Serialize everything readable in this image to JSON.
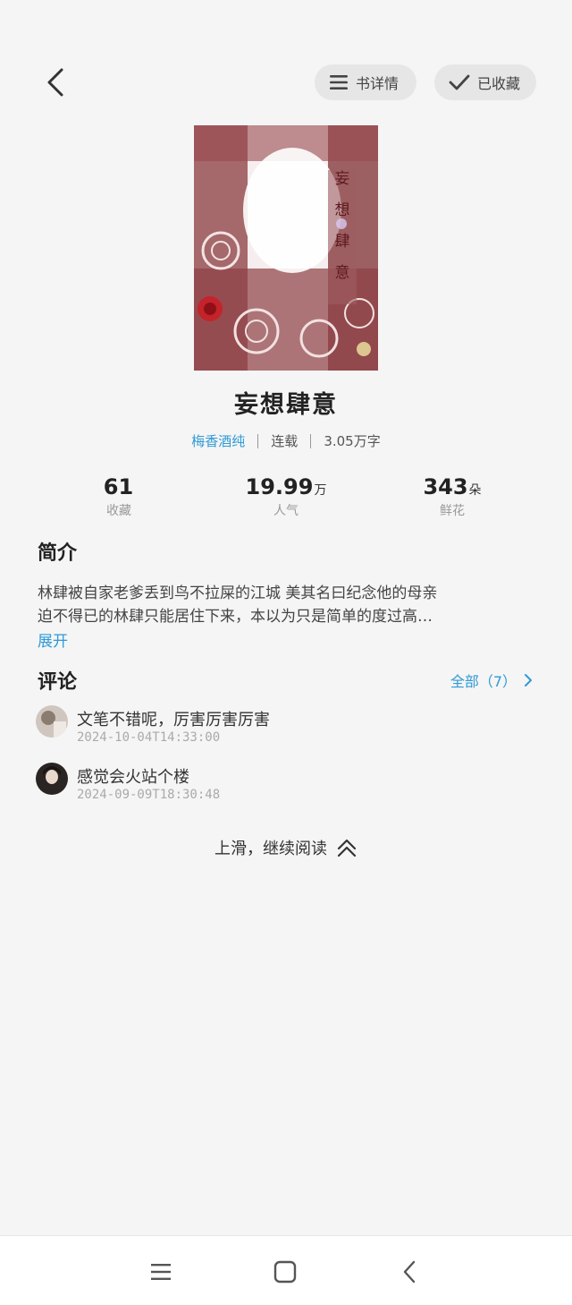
{
  "header": {
    "detail_label": "书详情",
    "fav_label": "已收藏"
  },
  "book": {
    "title": "妄想肆意",
    "author": "梅香酒纯",
    "status": "连载",
    "word_count": "3.05万字"
  },
  "stats": [
    {
      "value": "61",
      "unit": "",
      "label": "收藏"
    },
    {
      "value": "19.99",
      "unit": "万",
      "label": "人气"
    },
    {
      "value": "343",
      "unit": "朵",
      "label": "鲜花"
    }
  ],
  "intro": {
    "heading": "简介",
    "line1": "林肆被自家老爹丢到鸟不拉屎的江城 美其名曰纪念他的母亲",
    "line2": "迫不得已的林肆只能居住下来，本以为只是简单的度过高…",
    "expand": "展开"
  },
  "comments": {
    "heading": "评论",
    "all_label": "全部（7）",
    "items": [
      {
        "text": "文笔不错呢，厉害厉害厉害",
        "time": "2024-10-04T14:33:00"
      },
      {
        "text": "感觉会火站个楼",
        "time": "2024-09-09T18:30:48"
      }
    ]
  },
  "swipe_hint": "上滑，继续阅读",
  "colors": {
    "accent": "#2e9ad6",
    "background": "#f5f5f5"
  }
}
